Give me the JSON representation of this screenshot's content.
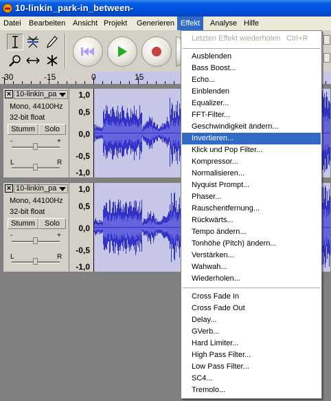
{
  "window": {
    "title": "10-linkin_park-in_between-"
  },
  "menubar": [
    {
      "label": "Datei",
      "active": false
    },
    {
      "label": "Bearbeiten",
      "active": false
    },
    {
      "label": "Ansicht",
      "active": false
    },
    {
      "label": "Projekt",
      "active": false
    },
    {
      "label": "Generieren",
      "active": false
    },
    {
      "label": "Effekt",
      "active": true
    },
    {
      "label": "Analyse",
      "active": false
    },
    {
      "label": "Hilfe",
      "active": false
    }
  ],
  "toolbar": {
    "tools": [
      "selection-tool",
      "envelope-tool",
      "draw-tool",
      "zoom-tool",
      "timeshift-tool",
      "multi-tool"
    ],
    "transport": [
      "skip-to-start",
      "play",
      "record"
    ]
  },
  "ruler": {
    "labels": [
      "-30",
      "-15",
      "0",
      "15"
    ]
  },
  "tracks": [
    {
      "name": "10-linkin_pa",
      "format": "Mono, 44100Hz",
      "bitdepth": "32-bit float",
      "mute": "Stumm",
      "solo": "Solo",
      "gain_minus": "-",
      "gain_plus": "+",
      "pan_left": "L",
      "pan_right": "R",
      "scale": [
        "1,0",
        "0,5",
        "0,0",
        "-0,5",
        "-1,0"
      ]
    },
    {
      "name": "10-linkin_pa",
      "format": "Mono, 44100Hz",
      "bitdepth": "32-bit float",
      "mute": "Stumm",
      "solo": "Solo",
      "gain_minus": "-",
      "gain_plus": "+",
      "pan_left": "L",
      "pan_right": "R",
      "scale": [
        "1,0",
        "0,5",
        "0,0",
        "-0,5",
        "-1,0"
      ]
    }
  ],
  "effect_menu": {
    "repeat_last": {
      "label": "Letzten Effekt wiederholen",
      "shortcut": "Ctrl+R"
    },
    "group1": [
      "Ausblenden",
      "Bass Boost...",
      "Echo...",
      "Einblenden",
      "Equalizer...",
      "FFT-Filter...",
      "Geschwindigkeit ändern...",
      "Invertieren...",
      "Klick und Pop Filter...",
      "Kompressor...",
      "Normalisieren...",
      "Nyquist Prompt...",
      "Phaser...",
      "Rauschentfernung...",
      "Rückwärts...",
      "Tempo ändern...",
      "Tonhöhe (Pitch) ändern...",
      "Verstärken...",
      "Wahwah...",
      "Wiederholen..."
    ],
    "highlighted": "Invertieren...",
    "group2": [
      "Cross Fade In",
      "Cross Fade Out",
      "Delay...",
      "GVerb...",
      "Hard Limiter...",
      "High Pass Filter...",
      "Low Pass Filter...",
      "SC4...",
      "Tremolo..."
    ]
  },
  "colors": {
    "menu_highlight": "#316ac5",
    "waveform": "#3232c8",
    "selection": "#c6c7e6"
  }
}
